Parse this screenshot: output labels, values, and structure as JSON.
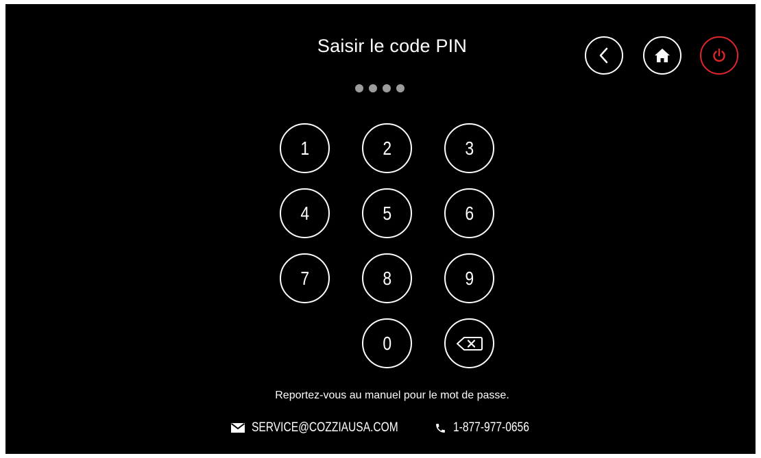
{
  "header": {
    "title": "Saisir le code PIN",
    "pin_dots": 4
  },
  "nav": {
    "back_icon": "chevron-left-icon",
    "home_icon": "home-icon",
    "power_icon": "power-icon",
    "power_color": "#e0262d"
  },
  "keypad": {
    "keys": [
      "1",
      "2",
      "3",
      "4",
      "5",
      "6",
      "7",
      "8",
      "9",
      "0"
    ],
    "backspace_icon": "backspace-icon"
  },
  "footer": {
    "note": "Reportez-vous au manuel pour le mot de passe.",
    "email": "SERVICE@COZZIAUSA.COM",
    "phone": "1-877-977-0656",
    "email_icon": "envelope-icon",
    "phone_icon": "phone-icon"
  }
}
